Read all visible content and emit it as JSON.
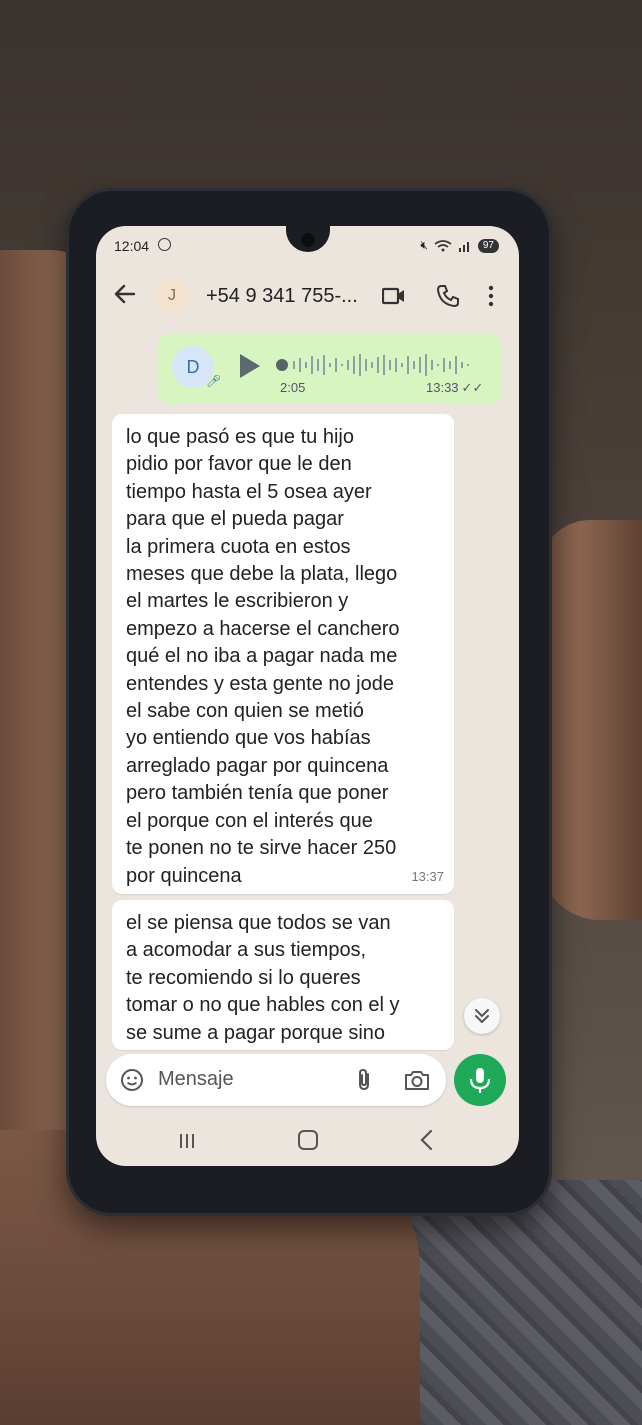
{
  "status_bar": {
    "time": "12:04",
    "battery": "97"
  },
  "header": {
    "avatar_initial": "J",
    "contact": "+54 9 341 755-..."
  },
  "voice_message": {
    "avatar_initial": "D",
    "duration": "2:05",
    "time": "13:33"
  },
  "messages": [
    {
      "text": "lo que pasó es que tu hijo\npidio por favor que le den\ntiempo hasta el 5 osea ayer\npara que el pueda pagar\nla primera cuota en estos\nmeses que debe la plata, llego\nel martes le escribieron y\nempezo a hacerse el canchero\nqué el no iba a pagar nada me\nentendes y esta gente no jode\nel sabe con quien se metió\nyo entiendo que vos habías\narreglado pagar por quincena\npero también tenía que poner\nel porque con el interés que\nte ponen no te sirve hacer 250\npor quincena",
      "time": "13:37"
    },
    {
      "text": "el se piensa que todos se van\na acomodar a sus tiempos,\nte recomiendo si lo queres\ntomar o no que hables con el y\nse sume a pagar porque sino",
      "time": ""
    }
  ],
  "composer": {
    "placeholder": "Mensaje"
  },
  "colors": {
    "outgoing_bubble": "#d7f5c1",
    "incoming_bubble": "#ffffff",
    "chat_background": "#ece5dd",
    "mic_button": "#1faa59"
  },
  "icons": [
    "back-arrow-icon",
    "video-call-icon",
    "phone-call-icon",
    "more-options-icon",
    "play-icon",
    "microphone-icon",
    "emoji-icon",
    "attach-icon",
    "camera-icon",
    "double-check-icon",
    "chevron-down-icon"
  ]
}
